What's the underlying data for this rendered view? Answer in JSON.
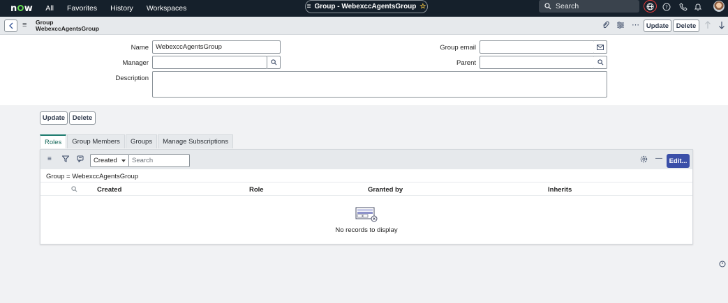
{
  "topnav": {
    "logo": "now",
    "menu": [
      "All",
      "Favorites",
      "History",
      "Workspaces"
    ],
    "context_title": "Group - WebexccAgentsGroup",
    "search_placeholder": "Search",
    "icons": [
      "globe-icon",
      "help-icon",
      "phone-icon",
      "bell-icon",
      "avatar"
    ]
  },
  "header": {
    "record_type": "Group",
    "record_name": "WebexccAgentsGroup",
    "update_label": "Update",
    "delete_label": "Delete"
  },
  "form": {
    "name_label": "Name",
    "name_value": "WebexccAgentsGroup",
    "manager_label": "Manager",
    "manager_value": "",
    "description_label": "Description",
    "description_value": "",
    "group_email_label": "Group email",
    "group_email_value": "",
    "parent_label": "Parent",
    "parent_value": ""
  },
  "bottom_buttons": {
    "update_label": "Update",
    "delete_label": "Delete"
  },
  "related": {
    "tabs": [
      "Roles",
      "Group Members",
      "Groups",
      "Manage Subscriptions"
    ],
    "active_tab": "Roles",
    "filter_select": "Created",
    "search_placeholder": "Search",
    "edit_label": "Edit...",
    "breadcrumb": "Group = WebexccAgentsGroup",
    "columns": [
      "Created",
      "Role",
      "Granted by",
      "Inherits"
    ],
    "empty_message": "No records to display"
  },
  "colors": {
    "nav_bg": "#15202b",
    "accent": "#3a4fa8",
    "active_tab": "#1b7a6e",
    "highlight_ring": "#e23b3b"
  }
}
